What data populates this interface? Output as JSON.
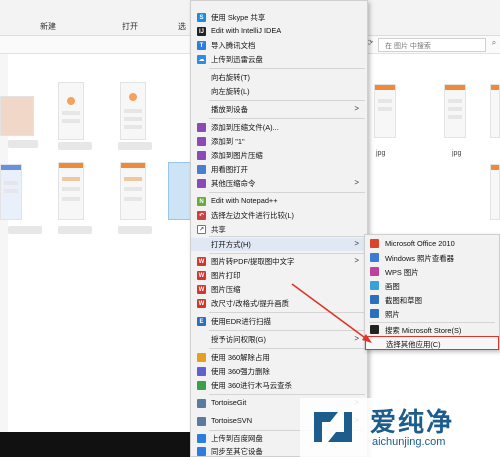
{
  "ribbon": {
    "new_label": "新建",
    "open_label": "打开",
    "cut_label": "选"
  },
  "search": {
    "placeholder": "在 图片 中搜索"
  },
  "files": {
    "label_1": "jpg",
    "label_2": "jpg"
  },
  "context_menu": {
    "items": [
      {
        "label": "使用 Skype 共享",
        "icon": "skype-icon",
        "color": "#1a8de0"
      },
      {
        "label": "Edit with IntelliJ IDEA",
        "icon": "intellij-icon",
        "color": "#222222"
      },
      {
        "label": "导入腾讯文档",
        "icon": "tencent-docs-icon",
        "color": "#2f7ce0"
      },
      {
        "label": "上传到迅雷云盘",
        "icon": "xunlei-cloud-icon",
        "color": "#2f8ae8"
      },
      {
        "label": "向右旋转(T)"
      },
      {
        "label": "向左旋转(L)"
      },
      {
        "label": "播放到设备",
        "arrow": ">"
      },
      {
        "label": "添加到压缩文件(A)...",
        "icon": "winrar-icon",
        "color": "#8a4bb5"
      },
      {
        "label": "添加到 \"1\"",
        "icon": "winrar-icon",
        "color": "#8a4bb5"
      },
      {
        "label": "添加到图片压缩",
        "icon": "winrar-icon",
        "color": "#8a4bb5"
      },
      {
        "label": "用看图打开",
        "icon": "viewer-icon",
        "color": "#4a7fd0"
      },
      {
        "label": "其他压缩命令",
        "icon": "winrar-icon",
        "color": "#8a4bb5",
        "arrow": ">"
      },
      {
        "label": "Edit with Notepad++",
        "icon": "notepadpp-icon",
        "color": "#6aaa3a"
      },
      {
        "label": "选择左边文件进行比较(L)",
        "icon": "compare-icon",
        "color": "#d04040"
      },
      {
        "label": "共享",
        "icon": "share-icon",
        "color": "#5a5a5a"
      },
      {
        "label": "打开方式(H)",
        "arrow": ">"
      },
      {
        "label": "图片转PDF/提取图中文字",
        "icon": "wps-w-icon",
        "color": "#d9342b",
        "arrow": ">"
      },
      {
        "label": "图片打印",
        "icon": "wps-w-icon",
        "color": "#d9342b"
      },
      {
        "label": "图片压缩",
        "icon": "wps-w-icon",
        "color": "#d9342b"
      },
      {
        "label": "改尺寸/改格式/提升画质",
        "icon": "wps-w-icon",
        "color": "#d9342b"
      },
      {
        "label": "使用EDR进行扫描",
        "icon": "edr-icon",
        "color": "#2b6fbf"
      },
      {
        "label": "授予访问权限(G)",
        "arrow": ">"
      },
      {
        "label": "使用 360解除占用",
        "icon": "360-icon",
        "color": "#e6a020"
      },
      {
        "label": "使用 360强力删除",
        "icon": "360-icon",
        "color": "#6060d0"
      },
      {
        "label": "使用 360进行木马云查杀",
        "icon": "360-icon",
        "color": "#3aa04a"
      },
      {
        "label": "TortoiseGit",
        "icon": "tortoisegit-icon",
        "color": "#5a7aa0",
        "arrow": ">"
      },
      {
        "label": "TortoiseSVN",
        "icon": "tortoisesvn-icon",
        "color": "#5a7aa0",
        "arrow": ">"
      },
      {
        "label": "上传到百度网盘",
        "icon": "baidu-netdisk-icon",
        "color": "#2f7ce0"
      },
      {
        "label": "同步至其它设备",
        "icon": "sync-icon",
        "color": "#2f7ce0"
      }
    ]
  },
  "open_with_submenu": {
    "items": [
      {
        "label": "Microsoft Office 2010",
        "icon": "office-icon",
        "color": "#d9442b"
      },
      {
        "label": "Windows 照片查看器",
        "icon": "photo-viewer-icon",
        "color": "#3a7bd5"
      },
      {
        "label": "WPS 图片",
        "icon": "wps-picture-icon",
        "color": "#c040a0"
      },
      {
        "label": "画图",
        "icon": "paint-icon",
        "color": "#3aa0d8"
      },
      {
        "label": "截图和草图",
        "icon": "snip-sketch-icon",
        "color": "#2b6fbf"
      },
      {
        "label": "照片",
        "icon": "photos-icon",
        "color": "#2b6fbf"
      },
      {
        "label": "搜索 Microsoft Store(S)",
        "icon": "store-icon",
        "color": "#222222"
      },
      {
        "label": "选择其他应用(C)"
      }
    ]
  },
  "watermark": {
    "cn": "爱纯净",
    "en": "aichunjing.com"
  },
  "colors": {
    "annotation": "#e0342a",
    "brand": "#1c5d8e"
  }
}
